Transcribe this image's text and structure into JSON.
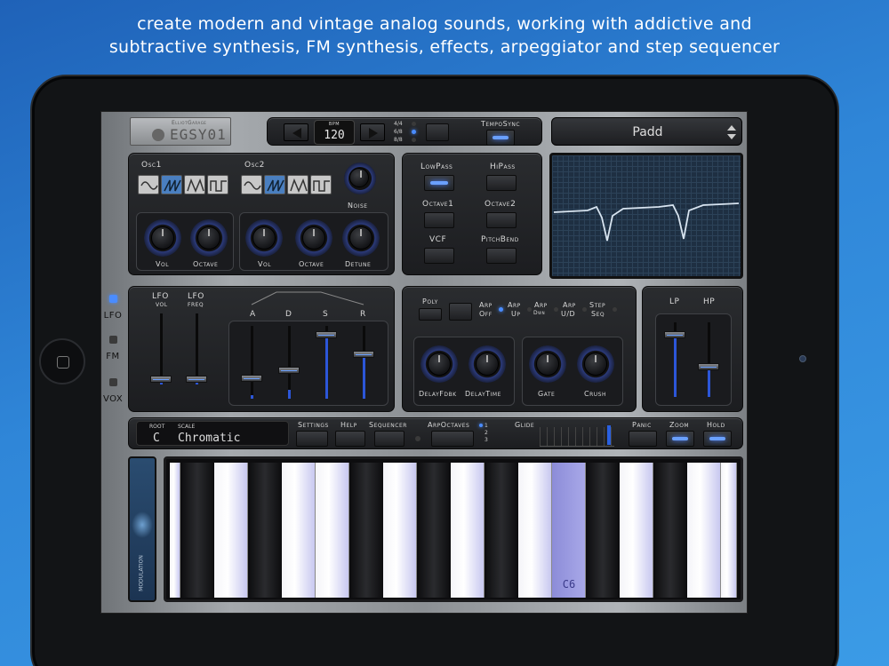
{
  "caption": {
    "line1": "create modern and vintage analog sounds, working with addictive and",
    "line2": "subtractive synthesis, FM synthesis, effects, arpeggiator and step sequencer"
  },
  "header": {
    "brand_small": "ElliotGarage",
    "brand": "EGSY01",
    "bpm_label": "BPM",
    "bpm_value": "120",
    "time_sigs": [
      "4/4",
      "6/8",
      "8/8"
    ],
    "tempo_sync": "TempoSync",
    "preset": "Padd"
  },
  "oscillators": {
    "osc1": "Osc1",
    "osc2": "Osc2",
    "noise": "Noise",
    "knobs": [
      "Vol",
      "Octave",
      "Vol",
      "Octave",
      "Detune"
    ]
  },
  "filter": {
    "buttons": [
      "LowPass",
      "HiPass",
      "Octave1",
      "Octave2",
      "VCF",
      "PitchBend"
    ]
  },
  "side_tabs": [
    "LFO",
    "FM",
    "VOX"
  ],
  "lfo_env": {
    "lfo_vol": [
      "LFO",
      "VOL"
    ],
    "lfo_freq": [
      "LFO",
      "FREQ"
    ],
    "adsr": [
      "A",
      "D",
      "S",
      "R"
    ]
  },
  "arp": {
    "poly": "Poly",
    "modes": [
      [
        "Arp",
        "Off"
      ],
      [
        "Arp",
        "Up"
      ],
      [
        "Arp",
        "Dwn"
      ],
      [
        "Arp",
        "U/D"
      ],
      [
        "Step",
        "Seq"
      ]
    ],
    "knobs": [
      "DelayFdbk",
      "DelayTime",
      "Gate",
      "Crush"
    ]
  },
  "lphp": {
    "lp": "LP",
    "hp": "HP"
  },
  "bottom_bar": {
    "root_label": "ROOT",
    "scale_label": "SCALE",
    "root_value": "C",
    "scale_value": "Chromatic",
    "buttons": [
      "Settings",
      "Help",
      "Sequencer",
      "ArpOctaves"
    ],
    "arp_octaves": [
      "1",
      "2",
      "3"
    ],
    "glide": "Glide",
    "panic": "Panic",
    "zoom": "Zoom",
    "hold": "Hold"
  },
  "keyboard": {
    "modulation": "MODULATION",
    "key_label": "C6"
  },
  "colors": {
    "accent": "#4a80ff",
    "background": "#2f86d8"
  }
}
